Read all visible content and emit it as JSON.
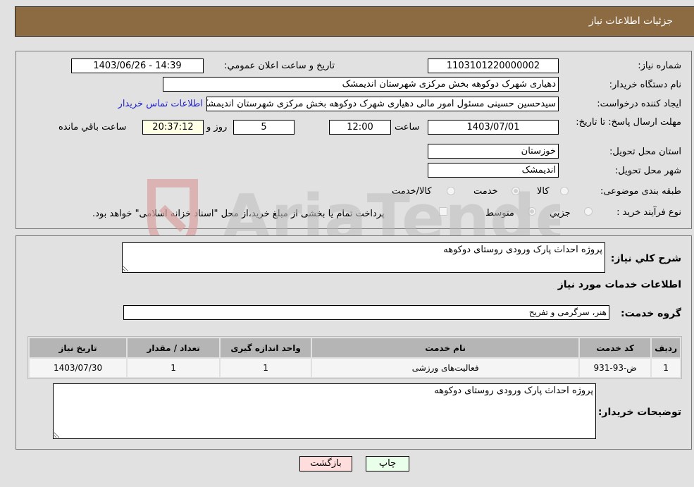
{
  "header": {
    "title": "جزئیات اطلاعات نیاز"
  },
  "fields": {
    "need_number": {
      "label": "شماره نیاز:",
      "value": "1103101220000002"
    },
    "announce_datetime": {
      "label": "تاریخ و ساعت اعلان عمومي:",
      "value": "1403/06/26 - 14:39"
    },
    "buyer_org": {
      "label": "نام دستگاه خریدار:",
      "value": "دهیاری شهرک دوکوهه بخش مرکزی شهرستان اندیمشک"
    },
    "requester": {
      "label": "ایجاد کننده درخواست:",
      "value": "سیدحسین حسینی مسئول امور مالی دهیاری شهرک دوکوهه بخش مرکزی شهرستان اندیمشک",
      "contact_link": "اطلاعات تماس خریدار"
    },
    "deadline": {
      "label": "مهلت ارسال پاسخ: تا تاریخ:",
      "date": "1403/07/01",
      "time_label": "ساعت",
      "time": "12:00",
      "days": "5",
      "days_label": "روز و",
      "remaining": "20:37:12",
      "remaining_label": "ساعت باقي مانده"
    },
    "province": {
      "label": "استان محل تحویل:",
      "value": "خوزستان"
    },
    "city": {
      "label": "شهر محل تحویل:",
      "value": "اندیمشک"
    },
    "category": {
      "label": "طبقه بندی موضوعی:",
      "options": [
        "کالا",
        "خدمت",
        "کالا/خدمت"
      ],
      "selected": "خدمت"
    },
    "purchase_type": {
      "label": "نوع فرآیند خرید :",
      "options": [
        "جزيي",
        "متوسط"
      ],
      "selected": "متوسط",
      "treasury_note": "پرداخت تمام یا بخشی از مبلغ خرید،از محل \"اسناد خزانه اسلامی\" خواهد بود."
    }
  },
  "details": {
    "summary_label": "شرح کلي نیاز:",
    "summary_value": "پروژه احداث پارک ورودی روستای دوکوهه",
    "services_title": "اطلاعات خدمات مورد نیاز",
    "service_group_label": "گروه خدمت:",
    "service_group_value": "هنر، سرگرمی و تفریح",
    "table": {
      "headers": [
        "ردیف",
        "کد خدمت",
        "نام خدمت",
        "واحد اندازه گیری",
        "تعداد / مقدار",
        "تاریخ نیاز"
      ],
      "rows": [
        [
          "1",
          "ض-93-931",
          "فعالیت‌های ورزشی",
          "1",
          "1",
          "1403/07/30"
        ]
      ]
    },
    "buyer_notes_label": "توضیحات خریدار:",
    "buyer_notes_value": "پروژه احداث پارک ورودی روستای دوکوهه"
  },
  "buttons": {
    "print": "چاپ",
    "back": "بازگشت"
  },
  "watermark": "AriaTender.neT",
  "colors": {
    "header_bg": "#8d6b42",
    "print_bg": "#eaffea",
    "back_bg": "#ffdddd",
    "link": "#2222cc"
  }
}
